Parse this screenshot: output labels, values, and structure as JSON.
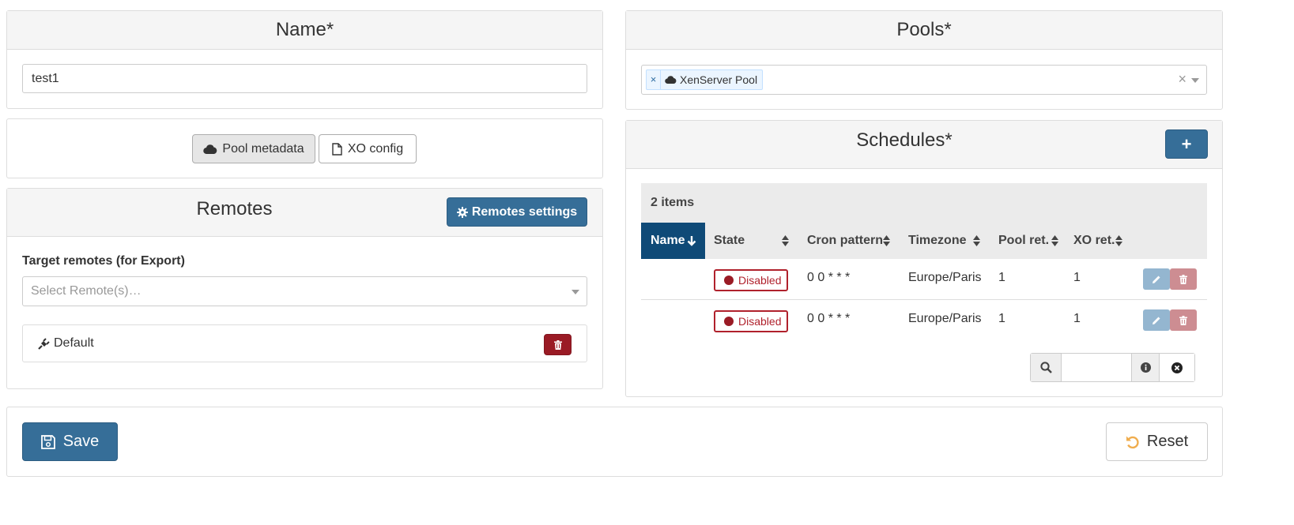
{
  "name_section": {
    "title": "Name*",
    "value": "test1"
  },
  "modes": {
    "pool_metadata_label": "Pool metadata",
    "xo_config_label": "XO config"
  },
  "remotes_section": {
    "title": "Remotes",
    "settings_button": "Remotes settings",
    "target_label": "Target remotes (for Export)",
    "select_placeholder": "Select Remote(s)…",
    "items": [
      {
        "label": "Default"
      }
    ]
  },
  "pools_section": {
    "title": "Pools*",
    "selected_tag": "XenServer Pool",
    "tag_remove": "×",
    "clear_symbol": "×"
  },
  "schedules_section": {
    "title": "Schedules*",
    "add_symbol": "+",
    "items_count": "2 items",
    "columns": [
      "Name",
      "State",
      "Cron pattern",
      "Timezone",
      "Pool ret.",
      "XO ret."
    ],
    "rows": [
      {
        "name": "",
        "state": "Disabled",
        "cron": "0 0 * * *",
        "timezone": "Europe/Paris",
        "pool_ret": "1",
        "xo_ret": "1"
      },
      {
        "name": "",
        "state": "Disabled",
        "cron": "0 0 * * *",
        "timezone": "Europe/Paris",
        "pool_ret": "1",
        "xo_ret": "1"
      }
    ],
    "filter_value": ""
  },
  "footer": {
    "save_label": "Save",
    "reset_label": "Reset"
  },
  "colors": {
    "primary": "#366e98",
    "sorted_header": "#0f4a77",
    "danger": "#9a1b25",
    "reset_icon": "#f0ad4e"
  }
}
